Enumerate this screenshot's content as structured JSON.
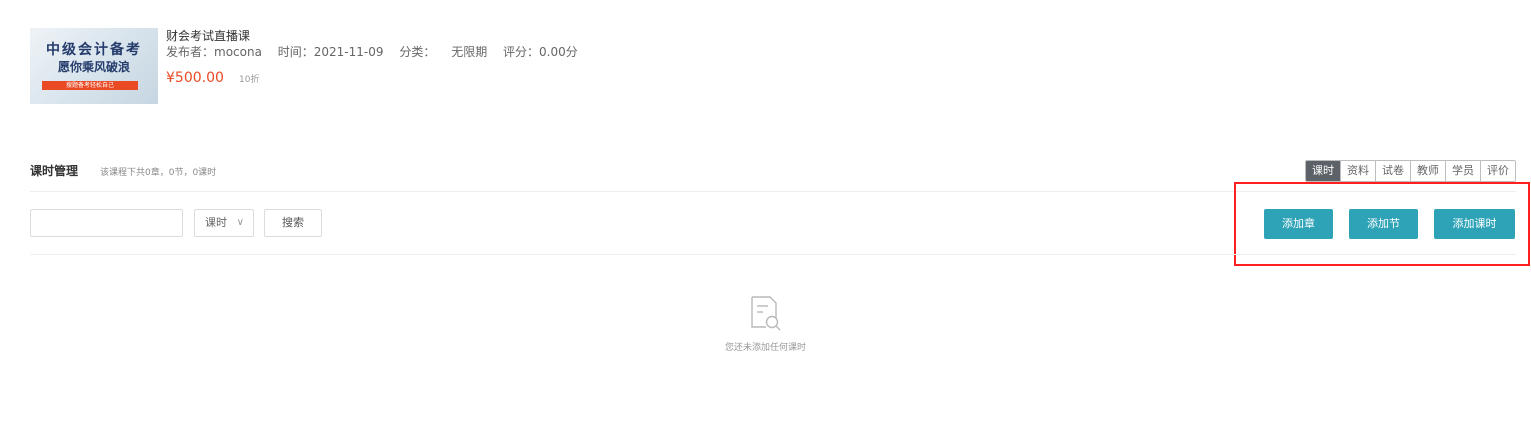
{
  "course": {
    "thumb_line1": "中级会计备考",
    "thumb_line2": "愿你乘风破浪",
    "thumb_ribbon": "搜题备考轻松自己",
    "title": "财会考试直播课",
    "publisher": "发布者：mocona",
    "time": "时间：2021-11-09",
    "category": "分类：",
    "validity": "无限期",
    "rating": "评分：0.00分",
    "price": "¥500.00",
    "discount": "10折"
  },
  "section": {
    "title": "课时管理",
    "summary": "该课程下共0章，0节，0课时"
  },
  "tabs": [
    {
      "label": "课时",
      "active": true
    },
    {
      "label": "资料",
      "active": false
    },
    {
      "label": "试卷",
      "active": false
    },
    {
      "label": "教师",
      "active": false
    },
    {
      "label": "学员",
      "active": false
    },
    {
      "label": "评价",
      "active": false
    }
  ],
  "toolbar": {
    "search_value": "",
    "type_selected": "课时",
    "search_label": "搜索",
    "add_chapter_label": "添加章",
    "add_section_label": "添加节",
    "add_lesson_label": "添加课时"
  },
  "empty": {
    "icon": "document-search-icon",
    "message": "您还未添加任何课时"
  },
  "colors": {
    "accent": "#2ea3b7",
    "price": "#e94a23",
    "tab_active": "#5c6267",
    "highlight": "#ff1f1f"
  }
}
